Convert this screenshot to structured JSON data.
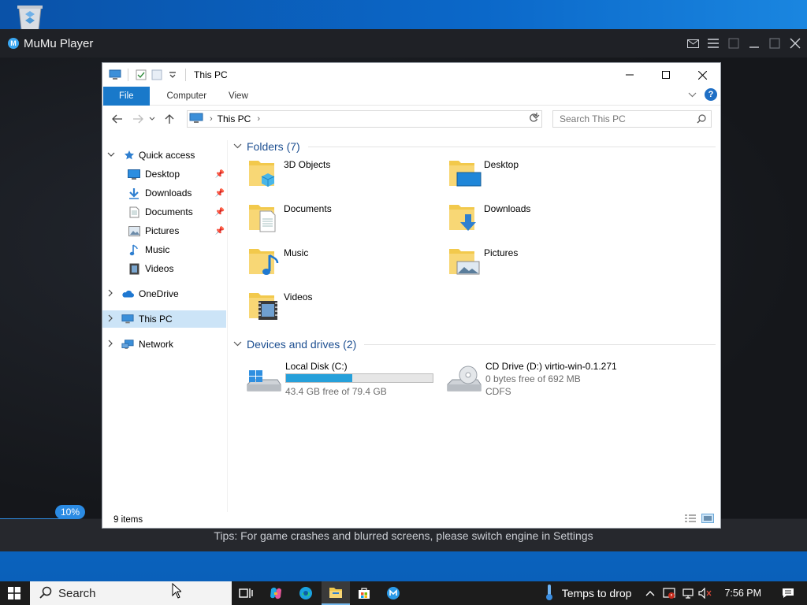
{
  "desktop": {
    "recycle_bin_icon": "recycle-bin-icon"
  },
  "mumu": {
    "title": "MuMu Player",
    "progress_label": "10%",
    "tips": "Tips: For game crashes and blurred screens, please switch engine in Settings"
  },
  "explorer": {
    "title": "This PC",
    "ribbon_tabs": [
      "File",
      "Computer",
      "View"
    ],
    "address": "This PC",
    "search_placeholder": "Search This PC",
    "nav": {
      "quick_access": "Quick access",
      "desktop": "Desktop",
      "downloads": "Downloads",
      "documents": "Documents",
      "pictures": "Pictures",
      "music": "Music",
      "videos": "Videos",
      "onedrive": "OneDrive",
      "this_pc": "This PC",
      "network": "Network"
    },
    "folders_header": "Folders (7)",
    "folders": [
      "3D Objects",
      "Desktop",
      "Documents",
      "Downloads",
      "Music",
      "Pictures",
      "Videos"
    ],
    "drives_header": "Devices and drives (2)",
    "drives": [
      {
        "name": "Local Disk (C:)",
        "free": "43.4 GB free of 79.4 GB",
        "used_fraction": 0.453
      },
      {
        "name": "CD Drive (D:) virtio-win-0.1.271",
        "free": "0 bytes free of 692 MB",
        "fs": "CDFS"
      }
    ],
    "status": "9 items"
  },
  "taskbar": {
    "search": "Search",
    "weather": "Temps to drop",
    "time": "7:56 PM"
  },
  "colors": {
    "accent": "#1979ca",
    "selection": "#cce4f7",
    "drive_fill": "#26a0da"
  }
}
